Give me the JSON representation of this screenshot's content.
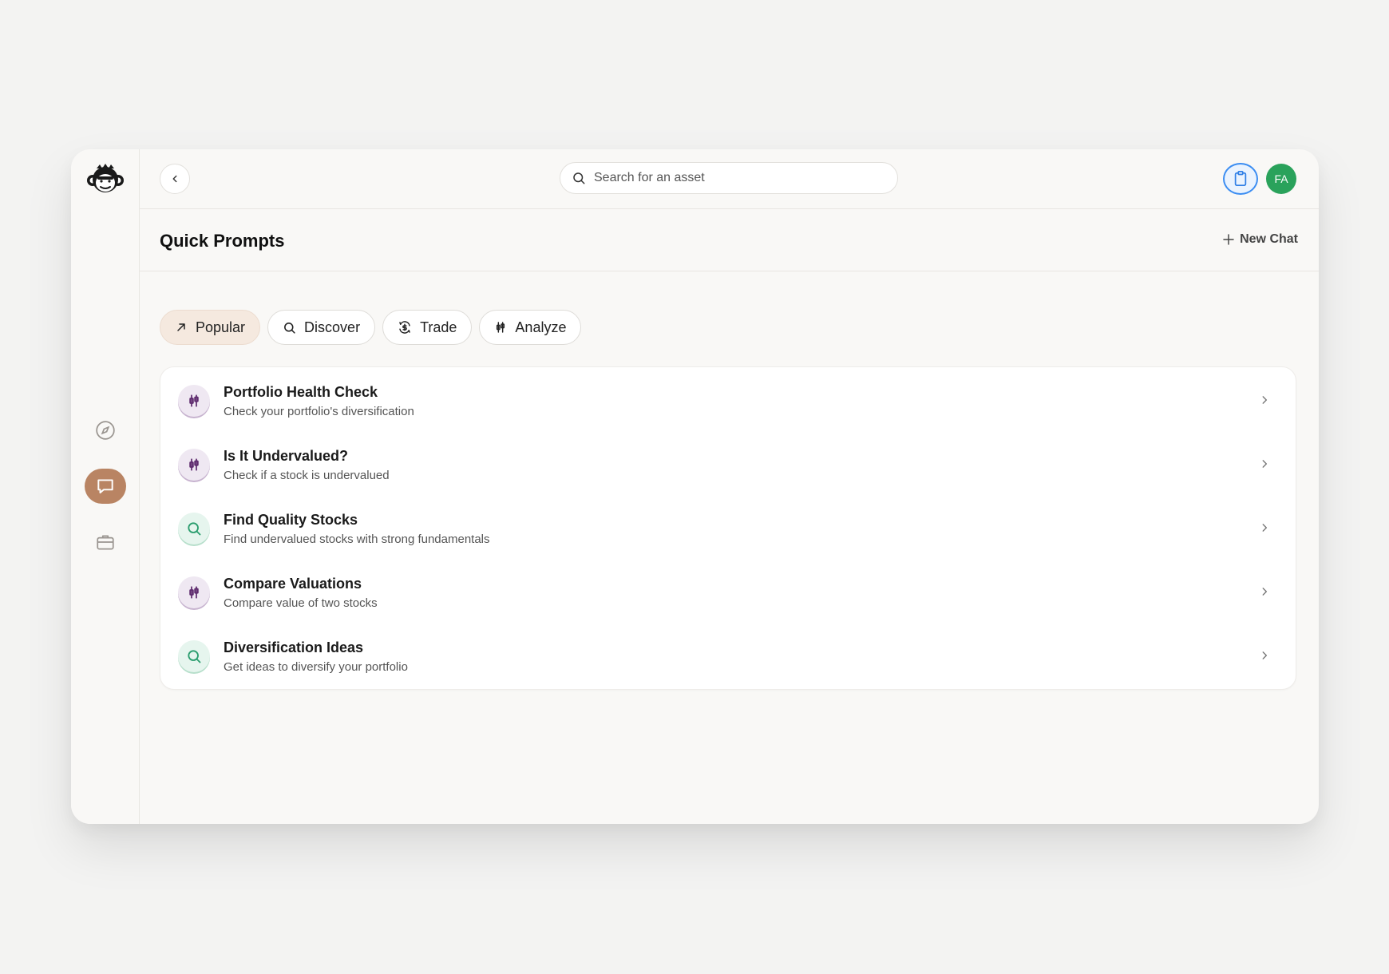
{
  "header": {
    "search_placeholder": "Search for an asset",
    "avatar_initials": "FA"
  },
  "titlebar": {
    "title": "Quick Prompts",
    "new_chat_label": "New Chat"
  },
  "tabs": [
    {
      "label": "Popular",
      "icon": "trending-arrow-icon",
      "active": true
    },
    {
      "label": "Discover",
      "icon": "search-icon",
      "active": false
    },
    {
      "label": "Trade",
      "icon": "exchange-icon",
      "active": false
    },
    {
      "label": "Analyze",
      "icon": "candlestick-icon",
      "active": false
    }
  ],
  "prompts": [
    {
      "title": "Portfolio Health Check",
      "description": "Check your portfolio's diversification",
      "icon": "candlestick-icon",
      "color": "purple"
    },
    {
      "title": "Is It Undervalued?",
      "description": "Check if a stock is undervalued",
      "icon": "candlestick-icon",
      "color": "purple"
    },
    {
      "title": "Find Quality Stocks",
      "description": "Find undervalued stocks with strong fundamentals",
      "icon": "search-icon",
      "color": "green"
    },
    {
      "title": "Compare Valuations",
      "description": "Compare value of two stocks",
      "icon": "candlestick-icon",
      "color": "purple"
    },
    {
      "title": "Diversification Ideas",
      "description": "Get ideas to diversify your portfolio",
      "icon": "search-icon",
      "color": "green"
    }
  ],
  "colors": {
    "accent_brown": "#b98463",
    "accent_blue": "#3b8df2",
    "avatar_green": "#2aa25b",
    "icon_purple": "#5e2b6e",
    "icon_green": "#2a9d6e"
  }
}
